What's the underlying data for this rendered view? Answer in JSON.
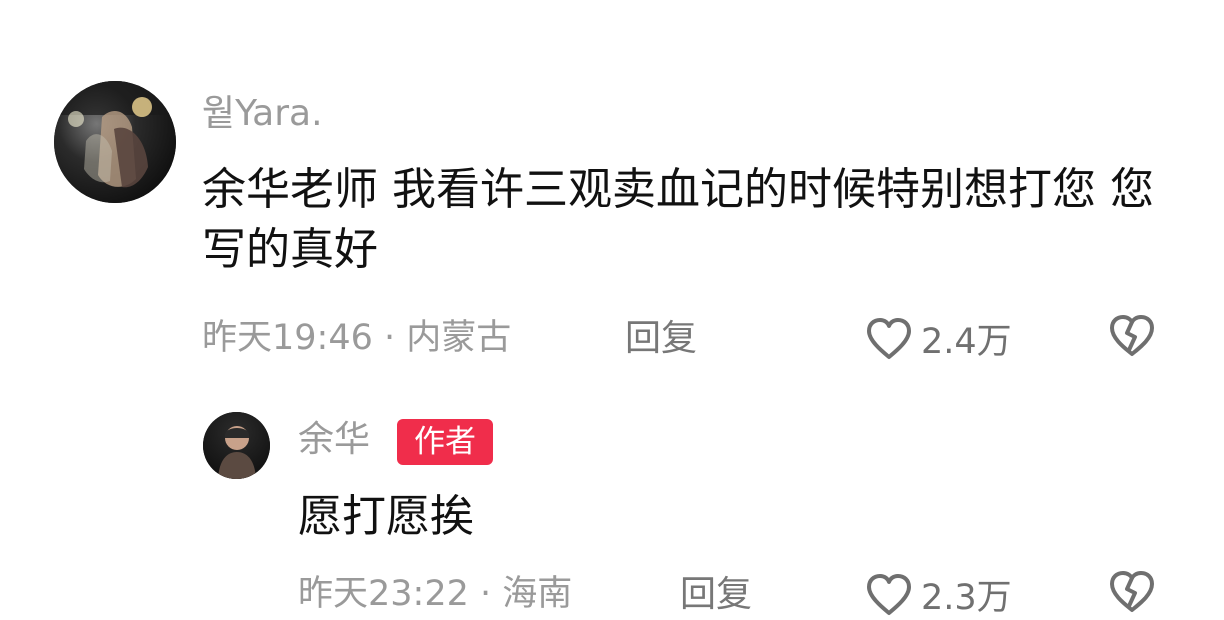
{
  "comments": [
    {
      "username": "웥Yara.",
      "text": "余华老师 我看许三观卖血记的时候特别想打您 您写的真好",
      "time": "昨天19:46",
      "location": "内蒙古",
      "reply_label": "回复",
      "likes": "2.4万"
    },
    {
      "username": "余华",
      "badge": "作者",
      "text": "愿打愿挨",
      "time": "昨天23:22",
      "location": "海南",
      "reply_label": "回复",
      "likes": "2.3万"
    }
  ],
  "icons": {
    "like": "heart-icon",
    "dislike": "broken-heart-icon"
  },
  "colors": {
    "badge_bg": "#f02d4b",
    "meta_text": "#9a9a9a",
    "body_text": "#111111"
  }
}
